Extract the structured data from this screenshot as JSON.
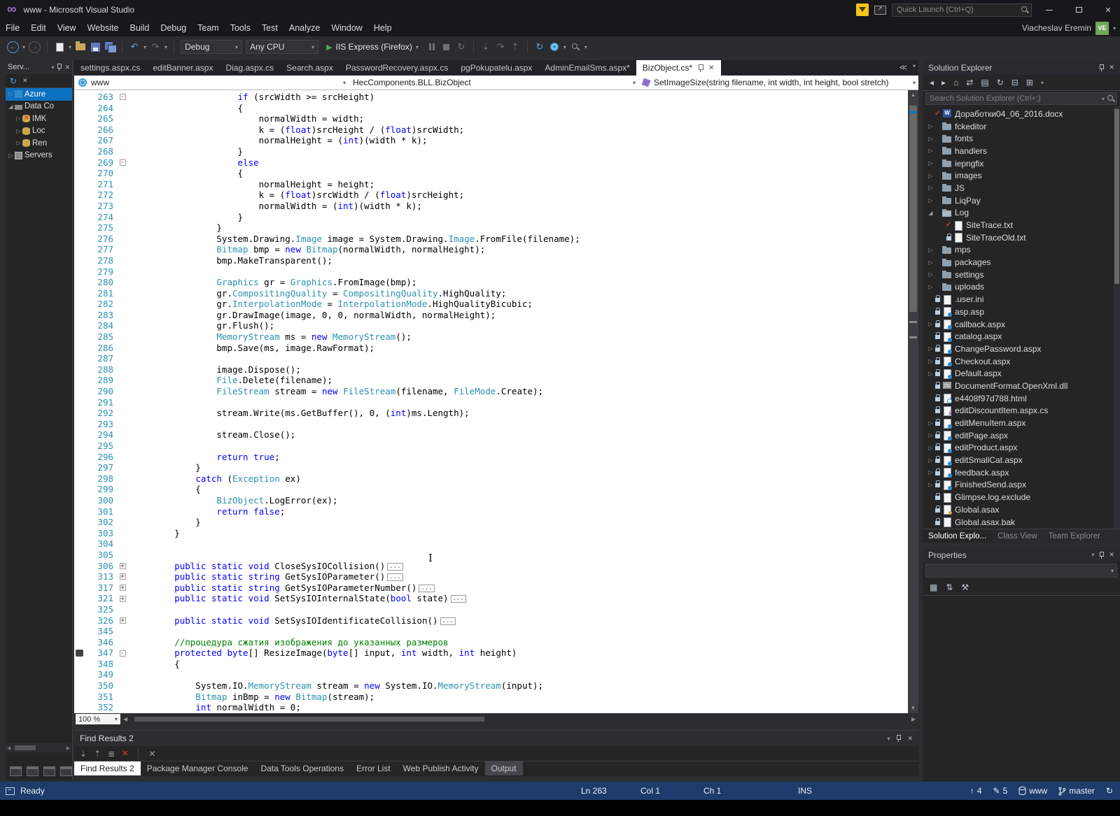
{
  "window": {
    "title": "www - Microsoft Visual Studio"
  },
  "titlebar": {
    "quick_launch_placeholder": "Quick Launch (Ctrl+Q)"
  },
  "menu": {
    "items": [
      "File",
      "Edit",
      "View",
      "Website",
      "Build",
      "Debug",
      "Team",
      "Tools",
      "Test",
      "Analyze",
      "Window",
      "Help"
    ],
    "user_name": "Viacheslav Eremin",
    "user_initials": "VE"
  },
  "toolbar": {
    "configuration": "Debug",
    "platform": "Any CPU",
    "start_label": "IIS Express (Firefox)"
  },
  "editor_tabs": [
    {
      "label": "settings.aspx.cs"
    },
    {
      "label": "editBanner.aspx"
    },
    {
      "label": "Diag.aspx.cs"
    },
    {
      "label": "Search.aspx"
    },
    {
      "label": "PasswordRecovery.aspx.cs"
    },
    {
      "label": "pgPokupatelu.aspx"
    },
    {
      "label": "AdminEmailSms.aspx*"
    },
    {
      "label": "BizObject.cs*",
      "active": true
    }
  ],
  "navbar": {
    "project": "www",
    "type_name": "HecComponents.BLL.BizObject",
    "member": "SetImageSize(string filename, int width, int height, bool stretch)"
  },
  "server_explorer": {
    "title": "Serv...",
    "items": [
      {
        "label": "Azure",
        "icon": "azure",
        "arrow": "r",
        "selected": true
      },
      {
        "label": "Data Co",
        "icon": "plug",
        "arrow": "d"
      },
      {
        "label": "IMK",
        "icon": "db-x",
        "arrow": "r",
        "indent": 1
      },
      {
        "label": "Loc",
        "icon": "db",
        "arrow": "r",
        "indent": 1
      },
      {
        "label": "Ren",
        "icon": "db",
        "arrow": "r",
        "indent": 1
      },
      {
        "label": "Servers",
        "icon": "server",
        "arrow": "r"
      }
    ]
  },
  "editor": {
    "zoom": "100 %",
    "keywords": [
      "if",
      "else",
      "new",
      "return",
      "true",
      "false",
      "catch",
      "public",
      "static",
      "void",
      "string",
      "bool",
      "protected",
      "byte",
      "int",
      "float"
    ],
    "types": [
      "Image",
      "Bitmap",
      "Graphics",
      "CompositingQuality",
      "InterpolationMode",
      "MemoryStream",
      "FileStream",
      "FileMode",
      "File",
      "Exception",
      "BizObject"
    ],
    "lines": [
      {
        "n": 263,
        "f": "-",
        "t": "                    if (srcWidth >= srcHeight)"
      },
      {
        "n": 264,
        "t": "                    {"
      },
      {
        "n": 265,
        "t": "                        normalWidth = width;"
      },
      {
        "n": 266,
        "t": "                        k = (float)srcHeight / (float)srcWidth;"
      },
      {
        "n": 267,
        "t": "                        normalHeight = (int)(width * k);"
      },
      {
        "n": 268,
        "t": "                    }"
      },
      {
        "n": 269,
        "f": "-",
        "t": "                    else"
      },
      {
        "n": 270,
        "t": "                    {"
      },
      {
        "n": 271,
        "t": "                        normalHeight = height;"
      },
      {
        "n": 272,
        "t": "                        k = (float)srcWidth / (float)srcHeight;"
      },
      {
        "n": 273,
        "t": "                        normalWidth = (int)(width * k);"
      },
      {
        "n": 274,
        "t": "                    }"
      },
      {
        "n": 275,
        "t": "                }"
      },
      {
        "n": 276,
        "t": "                System.Drawing.Image image = System.Drawing.Image.FromFile(filename);"
      },
      {
        "n": 277,
        "t": "                Bitmap bmp = new Bitmap(normalWidth, normalHeight);"
      },
      {
        "n": 278,
        "t": "                bmp.MakeTransparent();"
      },
      {
        "n": 279,
        "t": ""
      },
      {
        "n": 280,
        "t": "                Graphics gr = Graphics.FromImage(bmp);"
      },
      {
        "n": 281,
        "t": "                gr.CompositingQuality = CompositingQuality.HighQuality;"
      },
      {
        "n": 282,
        "t": "                gr.InterpolationMode = InterpolationMode.HighQualityBicubic;"
      },
      {
        "n": 283,
        "t": "                gr.DrawImage(image, 0, 0, normalWidth, normalHeight);"
      },
      {
        "n": 284,
        "t": "                gr.Flush();"
      },
      {
        "n": 285,
        "t": "                MemoryStream ms = new MemoryStream();"
      },
      {
        "n": 286,
        "t": "                bmp.Save(ms, image.RawFormat);"
      },
      {
        "n": 287,
        "t": ""
      },
      {
        "n": 288,
        "t": "                image.Dispose();"
      },
      {
        "n": 289,
        "t": "                File.Delete(filename);"
      },
      {
        "n": 290,
        "t": "                FileStream stream = new FileStream(filename, FileMode.Create);"
      },
      {
        "n": 291,
        "t": ""
      },
      {
        "n": 292,
        "t": "                stream.Write(ms.GetBuffer(), 0, (int)ms.Length);"
      },
      {
        "n": 293,
        "t": ""
      },
      {
        "n": 294,
        "t": "                stream.Close();"
      },
      {
        "n": 295,
        "t": ""
      },
      {
        "n": 296,
        "t": "                return true;"
      },
      {
        "n": 297,
        "t": "            }"
      },
      {
        "n": 298,
        "t": "            catch (Exception ex)"
      },
      {
        "n": 299,
        "t": "            {"
      },
      {
        "n": 300,
        "t": "                BizObject.LogError(ex);"
      },
      {
        "n": 301,
        "t": "                return false;"
      },
      {
        "n": 302,
        "t": "            }"
      },
      {
        "n": 303,
        "t": "        }"
      },
      {
        "n": 304,
        "t": ""
      },
      {
        "n": 305,
        "t": ""
      },
      {
        "n": 306,
        "f": "+",
        "e": true,
        "t": "        public static void CloseSysIOCollision()"
      },
      {
        "n": 313,
        "f": "+",
        "e": true,
        "t": "        public static string GetSysIOParameter()"
      },
      {
        "n": 317,
        "f": "+",
        "e": true,
        "t": "        public static string GetSysIOParameterNumber()"
      },
      {
        "n": 321,
        "f": "+",
        "e": true,
        "t": "        public static void SetSysIOInternalState(bool state)"
      },
      {
        "n": 325,
        "t": ""
      },
      {
        "n": 326,
        "f": "+",
        "e": true,
        "t": "        public static void SetSysIOIdentificateCollision()"
      },
      {
        "n": 345,
        "t": ""
      },
      {
        "n": 346,
        "t": "        //процедура сжатия изображения до указанных размеров"
      },
      {
        "n": 347,
        "f": "-",
        "m": true,
        "t": "        protected byte[] ResizeImage(byte[] input, int width, int height)"
      },
      {
        "n": 348,
        "t": "        {"
      },
      {
        "n": 349,
        "t": ""
      },
      {
        "n": 350,
        "t": "            System.IO.MemoryStream stream = new System.IO.MemoryStream(input);"
      },
      {
        "n": 351,
        "t": "            Bitmap inBmp = new Bitmap(stream);"
      },
      {
        "n": 352,
        "t": "            int normalWidth = 0;"
      }
    ]
  },
  "solution_explorer": {
    "title": "Solution Explorer",
    "search_placeholder": "Search Solution Explorer (Ctrl+;)",
    "tabs": [
      "Solution Explo...",
      "Class View",
      "Team Explorer"
    ],
    "items": [
      {
        "label": "Доработки04_06_2016.docx",
        "icon": "word",
        "mark": "check"
      },
      {
        "label": "fckeditor",
        "icon": "folder",
        "arrow": "r"
      },
      {
        "label": "fonts",
        "icon": "folder",
        "arrow": "r"
      },
      {
        "label": "handlers",
        "icon": "folder",
        "arrow": "r"
      },
      {
        "label": "iepngfix",
        "icon": "folder",
        "arrow": "r"
      },
      {
        "label": "images",
        "icon": "folder",
        "arrow": "r"
      },
      {
        "label": "JS",
        "icon": "folder",
        "arrow": "r"
      },
      {
        "label": "LiqPay",
        "icon": "folder",
        "arrow": "r"
      },
      {
        "label": "Log",
        "icon": "folder-open",
        "arrow": "d"
      },
      {
        "label": "SiteTrace.txt",
        "icon": "doc",
        "mark": "check",
        "indent": 1
      },
      {
        "label": "SiteTraceOld.txt",
        "icon": "doc",
        "mark": "lock",
        "indent": 1
      },
      {
        "label": "mps",
        "icon": "folder",
        "arrow": "r"
      },
      {
        "label": "packages",
        "icon": "folder",
        "arrow": "r"
      },
      {
        "label": "settings",
        "icon": "folder",
        "arrow": "r"
      },
      {
        "label": "uploads",
        "icon": "folder",
        "arrow": "r"
      },
      {
        "label": ".user.ini",
        "icon": "doc",
        "mark": "lock"
      },
      {
        "label": "asp.asp",
        "icon": "aspx",
        "mark": "lock"
      },
      {
        "label": "callback.aspx",
        "icon": "aspx",
        "mark": "lock",
        "arrow": "r"
      },
      {
        "label": "catalog.aspx",
        "icon": "aspx",
        "mark": "lock"
      },
      {
        "label": "ChangePassword.aspx",
        "icon": "aspx",
        "mark": "lock",
        "arrow": "r"
      },
      {
        "label": "Checkout.aspx",
        "icon": "aspx",
        "mark": "lock",
        "arrow": "r"
      },
      {
        "label": "Default.aspx",
        "icon": "aspx",
        "mark": "lock",
        "arrow": "r"
      },
      {
        "label": "DocumentFormat.OpenXml.dll",
        "icon": "dll",
        "mark": "lock"
      },
      {
        "label": "e4408f97d788.html",
        "icon": "html",
        "mark": "lock"
      },
      {
        "label": "editDiscountItem.aspx.cs",
        "icon": "cs",
        "mark": "lock"
      },
      {
        "label": "editMenuItem.aspx",
        "icon": "aspx",
        "mark": "lock",
        "arrow": "r"
      },
      {
        "label": "editPage.aspx",
        "icon": "aspx",
        "mark": "lock",
        "arrow": "r"
      },
      {
        "label": "editProduct.aspx",
        "icon": "aspx",
        "mark": "lock",
        "arrow": "r"
      },
      {
        "label": "editSmallCat.aspx",
        "icon": "aspx",
        "mark": "lock",
        "arrow": "r"
      },
      {
        "label": "feedback.aspx",
        "icon": "aspx",
        "mark": "lock",
        "arrow": "r"
      },
      {
        "label": "FinishedSend.aspx",
        "icon": "aspx",
        "mark": "lock",
        "arrow": "r"
      },
      {
        "label": "Glimpse.log.exclude",
        "icon": "doc",
        "mark": "lock"
      },
      {
        "label": "Global.asax",
        "icon": "asax",
        "mark": "lock"
      },
      {
        "label": "Global.asax.bak",
        "icon": "doc",
        "mark": "lock"
      }
    ]
  },
  "properties": {
    "title": "Properties"
  },
  "find_results": {
    "title": "Find Results 2",
    "tabs": [
      {
        "label": "Find Results 2",
        "active": true
      },
      {
        "label": "Package Manager Console"
      },
      {
        "label": "Data Tools Operations"
      },
      {
        "label": "Error List"
      },
      {
        "label": "Web Publish Activity"
      },
      {
        "label": "Output",
        "highlight": true
      }
    ]
  },
  "statusbar": {
    "status": "Ready",
    "line": "Ln 263",
    "column": "Col 1",
    "character": "Ch 1",
    "insert_mode": "INS",
    "up_count": "4",
    "edit_count": "5",
    "repo": "www",
    "branch": "master"
  }
}
